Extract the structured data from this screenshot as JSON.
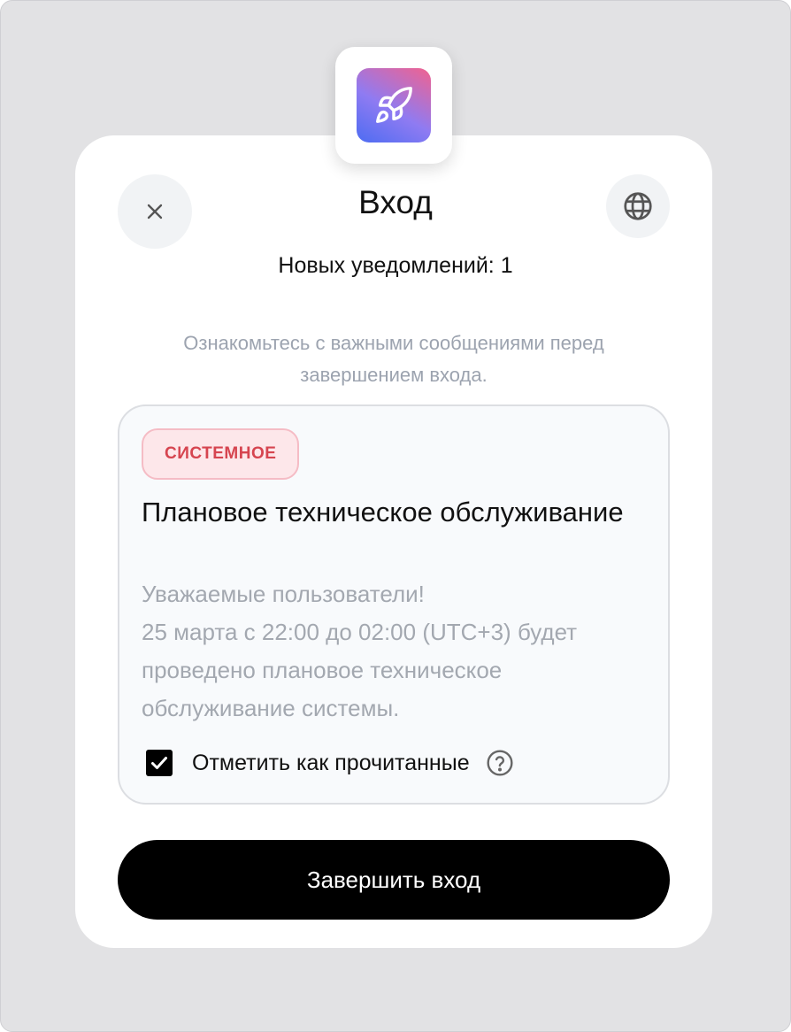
{
  "dialog": {
    "title": "Вход",
    "notification_count_text": "Новых уведомлений: 1",
    "hint": "Ознакомьтесь с важными сообщениями перед завершением входа.",
    "app_icon": "rocket-icon",
    "close_icon": "close-icon",
    "language_icon": "globe-icon"
  },
  "notification": {
    "badge": "СИСТЕМНОЕ",
    "title": "Плановое техническое обслуживание",
    "body_lines": [
      "Уважаемые пользователи!",
      "25 марта с 22:00 до 02:00 (UTC+3) будет проведено плановое техническое обслуживание системы."
    ],
    "mark_read_label": "Отметить как прочитанные",
    "mark_read_checked": true,
    "help_icon": "question-circle-icon"
  },
  "actions": {
    "submit_label": "Завершить вход"
  },
  "colors": {
    "primary": "#000000",
    "badge_bg": "#fde7ea",
    "badge_text": "#d64550",
    "muted_text": "#9ca3af"
  }
}
